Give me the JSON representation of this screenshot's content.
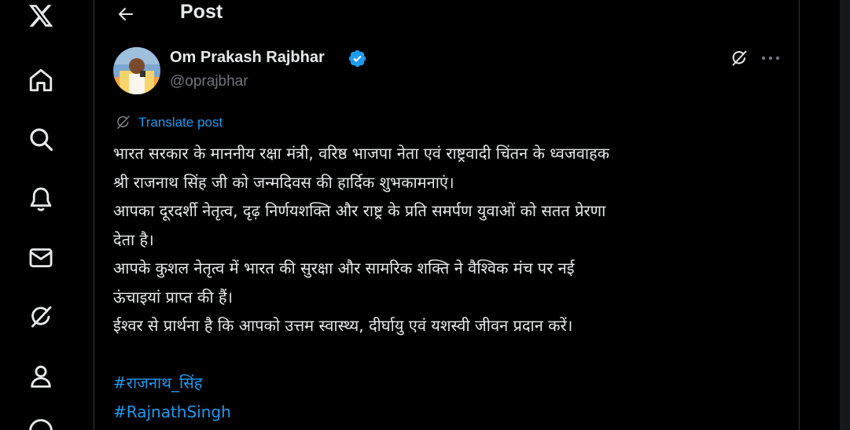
{
  "header": {
    "title": "Post"
  },
  "nav": {
    "items": [
      {
        "name": "x-logo-icon"
      },
      {
        "name": "home-icon"
      },
      {
        "name": "search-icon"
      },
      {
        "name": "notifications-bell-icon"
      },
      {
        "name": "messages-envelope-icon"
      },
      {
        "name": "grok-icon"
      },
      {
        "name": "profile-person-icon"
      }
    ]
  },
  "author": {
    "name": "Om Prakash Rajbhar",
    "handle": "@oprajbhar",
    "verified": true
  },
  "translate": {
    "label": "Translate post"
  },
  "post": {
    "lines": [
      "भारत सरकार के माननीय रक्षा मंत्री, वरिष्ठ भाजपा नेता एवं राष्ट्रवादी चिंतन के ध्वजवाहक",
      "श्री राजनाथ सिंह जी को जन्मदिवस की हार्दिक शुभकामनाएं।",
      "आपका दूरदर्शी नेतृत्व, दृढ़ निर्णयशक्ति और राष्ट्र के प्रति समर्पण युवाओं को सतत प्रेरणा",
      "देता है।",
      "आपके कुशल नेतृत्व में भारत की सुरक्षा और सामरिक शक्ति ने वैश्विक मंच पर नई",
      "ऊंचाइयां प्राप्त की हैं।",
      "ईश्वर से प्रार्थना है कि आपको उत्तम स्वास्थ्य, दीर्घायु एवं यशस्वी जीवन प्रदान करें।"
    ],
    "hashtags": [
      "#राजनाथ_सिंह",
      "#RajnathSingh"
    ]
  },
  "colors": {
    "background": "#000000",
    "text": "#e7e9ea",
    "muted": "#71767b",
    "accent": "#1d9bf0",
    "border": "#2f3336"
  }
}
